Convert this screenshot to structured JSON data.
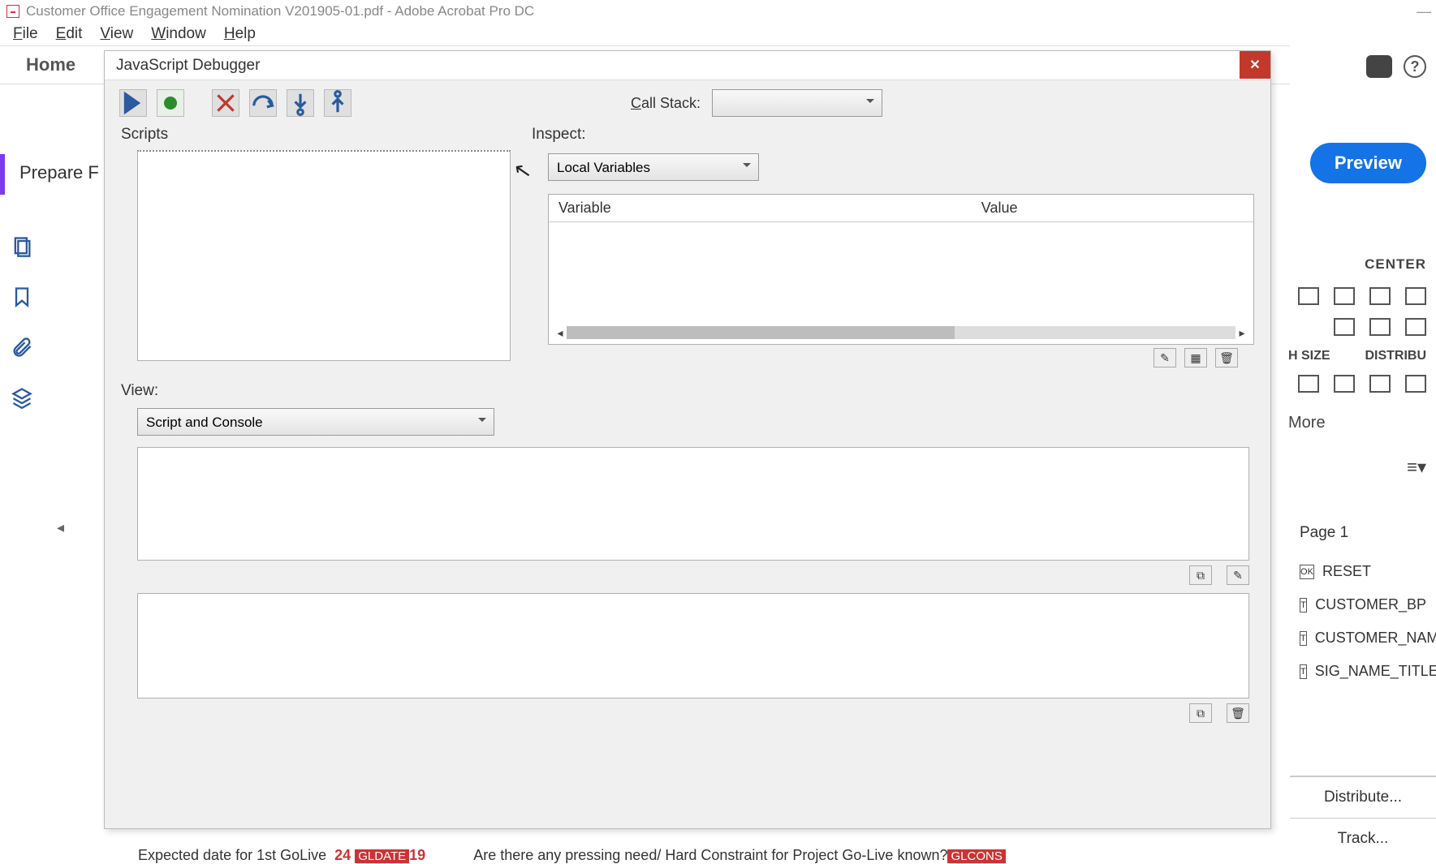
{
  "window": {
    "title": "Customer Office Engagement Nomination V201905-01.pdf - Adobe Acrobat Pro DC"
  },
  "menu": {
    "file": "File",
    "edit": "Edit",
    "view": "View",
    "window": "Window",
    "help": "Help"
  },
  "toolbar": {
    "home": "Home",
    "prepare_form": "Prepare F"
  },
  "right": {
    "preview": "Preview",
    "center": "CENTER",
    "h_size": "H SIZE",
    "distribu": "DISTRIBU",
    "more": "More",
    "fields_header": "Page 1",
    "fields": [
      "RESET",
      "CUSTOMER_BP",
      "CUSTOMER_NAME",
      "SIG_NAME_TITLE"
    ],
    "distribute_btn": "Distribute...",
    "track_btn": "Track..."
  },
  "debugger": {
    "title": "JavaScript Debugger",
    "call_stack_label": "Call Stack:",
    "call_stack_value": "",
    "scripts_label": "Scripts",
    "inspect_label": "Inspect:",
    "inspect_combo": "Local Variables",
    "var_col": "Variable",
    "val_col": "Value",
    "view_label": "View:",
    "view_combo": "Script and Console"
  },
  "bottom": {
    "left_text": "Expected date for 1st GoLive",
    "left_badge_pre": "24",
    "left_badge": "GLDATE",
    "left_badge_post": "19",
    "right_text": "Are there any pressing need/ Hard Constraint for Project Go-Live known?",
    "right_badge": "GLCONS"
  }
}
